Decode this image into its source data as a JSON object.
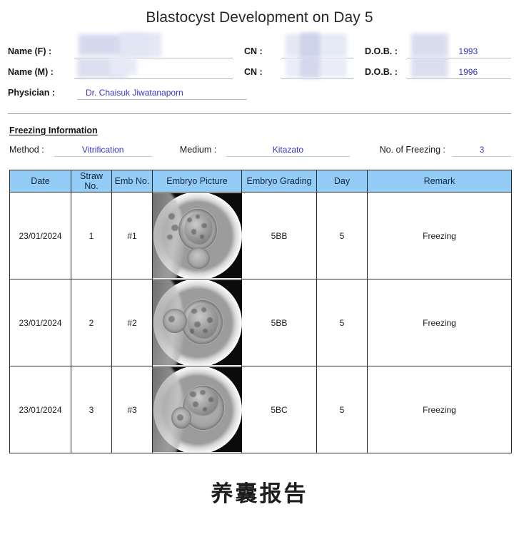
{
  "document": {
    "title": "Blastocyst Development on Day 5",
    "footer_note": "养囊报告"
  },
  "patient": {
    "name_f_label": "Name (F) :",
    "name_f_value": "",
    "name_m_label": "Name (M) :",
    "name_m_value": "",
    "cn_label": "CN :",
    "cn_f_value": "",
    "cn_m_value": "",
    "dob_label": "D.O.B. :",
    "dob_f_value": "1993",
    "dob_m_value": "1996",
    "physician_label": "Physician :",
    "physician_value": "Dr. Chaisuk  Jiwatanaporn"
  },
  "freezing": {
    "section_title": "Freezing Information",
    "method_label": "Method :",
    "method_value": "Vitrification",
    "medium_label": "Medium :",
    "medium_value": "Kitazato",
    "count_label": "No. of Freezing :",
    "count_value": "3"
  },
  "table": {
    "columns": [
      "Date",
      "Straw No.",
      "Emb No.",
      "Embryo Picture",
      "Embryo Grading",
      "Day",
      "Remark"
    ],
    "rows": [
      {
        "date": "23/01/2024",
        "straw_no": "1",
        "emb_no": "#1",
        "picture_alt": "blastocyst-micrograph-1",
        "grading": "5BB",
        "day": "5",
        "remark": "Freezing"
      },
      {
        "date": "23/01/2024",
        "straw_no": "2",
        "emb_no": "#2",
        "picture_alt": "blastocyst-micrograph-2",
        "grading": "5BB",
        "day": "5",
        "remark": "Freezing"
      },
      {
        "date": "23/01/2024",
        "straw_no": "3",
        "emb_no": "#3",
        "picture_alt": "blastocyst-micrograph-3",
        "grading": "5BC",
        "day": "5",
        "remark": "Freezing"
      }
    ]
  },
  "colors": {
    "table_header_blue": "#93CDF7",
    "value_blue": "#3A36C8",
    "redaction_lavender": "#D9DCEF",
    "border_dark": "#2B2B2B"
  }
}
